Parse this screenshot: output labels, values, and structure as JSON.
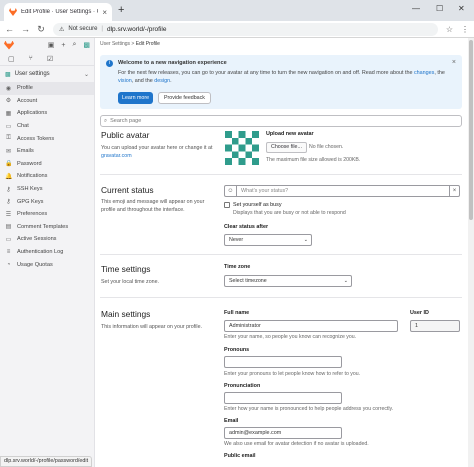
{
  "browser": {
    "tab_title": "Edit Profile · User Settings · GitL...",
    "tab_close": "×",
    "new_tab": "+",
    "security_label": "Not secure",
    "url": "dlp.srv.world/-/profile",
    "status_url": "dlp.srv.world/-/profile/password/edit",
    "win_min": "—",
    "win_max": "☐",
    "win_close": "✕"
  },
  "sidebar": {
    "section_label": "User settings",
    "items": [
      {
        "label": "Profile",
        "icon": "account-icon",
        "glyph": "◉",
        "active": true
      },
      {
        "label": "Account",
        "icon": "user-icon",
        "glyph": "⚙"
      },
      {
        "label": "Applications",
        "icon": "applications-icon",
        "glyph": "▦"
      },
      {
        "label": "Chat",
        "icon": "chat-icon",
        "glyph": "▭"
      },
      {
        "label": "Access Tokens",
        "icon": "token-icon",
        "glyph": "⚿"
      },
      {
        "label": "Emails",
        "icon": "mail-icon",
        "glyph": "✉"
      },
      {
        "label": "Password",
        "icon": "lock-icon",
        "glyph": "🔒"
      },
      {
        "label": "Notifications",
        "icon": "bell-icon",
        "glyph": "🔔"
      },
      {
        "label": "SSH Keys",
        "icon": "key-icon",
        "glyph": "⚷"
      },
      {
        "label": "GPG Keys",
        "icon": "key-icon",
        "glyph": "⚷"
      },
      {
        "label": "Preferences",
        "icon": "preferences-icon",
        "glyph": "☰"
      },
      {
        "label": "Comment Templates",
        "icon": "comment-icon",
        "glyph": "▤"
      },
      {
        "label": "Active Sessions",
        "icon": "monitor-icon",
        "glyph": "▭"
      },
      {
        "label": "Authentication Log",
        "icon": "log-icon",
        "glyph": "≡"
      },
      {
        "label": "Usage Quotas",
        "icon": "quota-icon",
        "glyph": "◔"
      }
    ]
  },
  "breadcrumbs": {
    "parent": "User Settings",
    "separator": ">",
    "current": "Edit Profile"
  },
  "banner": {
    "title": "Welcome to a new navigation experience",
    "text_1": "For the next few releases, you can go to your avatar at any time to turn the new navigation on and off. Read more about the ",
    "link_changes": "changes",
    "text_2": ", the ",
    "link_vision": "vision",
    "text_3": ", and the ",
    "link_design": "design",
    "text_4": ".",
    "primary_button": "Learn more",
    "secondary_button": "Provide feedback"
  },
  "search": {
    "placeholder": "Search page"
  },
  "public_avatar": {
    "title": "Public avatar",
    "desc_1": "You can upload your avatar here or change it at ",
    "desc_link": "gravatar.com",
    "upload_label": "Upload new avatar",
    "choose_button": "Choose file...",
    "no_file": "No file chosen.",
    "max_size": "The maximum file size allowed is 200KB."
  },
  "current_status": {
    "title": "Current status",
    "desc": "This emoji and message will appear on your profile and throughout the interface.",
    "placeholder": "What's your status?",
    "busy_label": "Set yourself as busy",
    "busy_hint": "Displays that you are busy or not able to respond",
    "clear_label": "Clear status after",
    "clear_value": "Never"
  },
  "time_settings": {
    "title": "Time settings",
    "desc": "Set your local time zone.",
    "zone_label": "Time zone",
    "zone_value": "Select timezone"
  },
  "main_settings": {
    "title": "Main settings",
    "desc": "This information will appear on your profile.",
    "full_name_label": "Full name",
    "full_name_value": "Administrator",
    "full_name_hint": "Enter your name, so people you know can recognize you.",
    "user_id_label": "User ID",
    "user_id_value": "1",
    "pronouns_label": "Pronouns",
    "pronouns_hint": "Enter your pronouns to let people know how to refer to you.",
    "pronunciation_label": "Pronunciation",
    "pronunciation_hint": "Enter how your name is pronounced to help people address you correctly.",
    "email_label": "Email",
    "email_value": "admin@example.com",
    "email_hint": "We also use email for avatar detection if no avatar is uploaded.",
    "public_email_label": "Public email"
  },
  "colors": {
    "brand": "#fc6d26",
    "primary": "#1f75cb",
    "avatar": "#2f9c8c"
  }
}
